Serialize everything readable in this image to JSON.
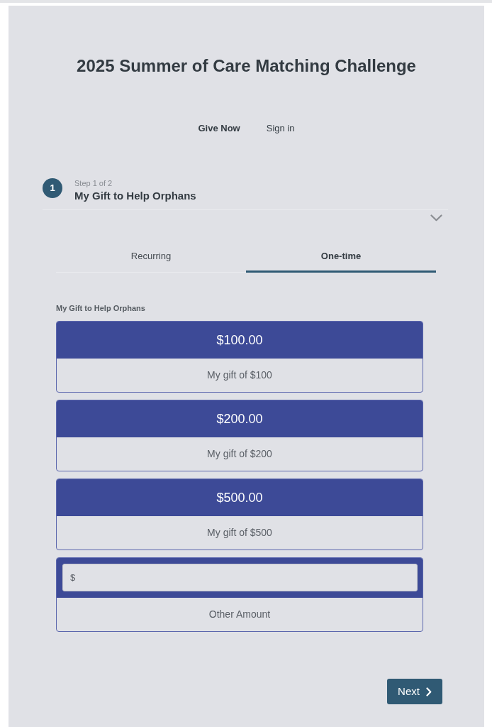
{
  "header": {
    "title": "2025 Summer of Care Matching Challenge"
  },
  "nav": [
    {
      "label": "Give Now",
      "selected": true
    },
    {
      "label": "Sign in",
      "selected": false
    }
  ],
  "step": {
    "number": "1",
    "counter": "Step 1 of 2",
    "title": "My Gift to Help Orphans"
  },
  "frequency_tabs": [
    {
      "label": "Recurring",
      "selected": false
    },
    {
      "label": "One-time",
      "selected": true
    }
  ],
  "gift_field": {
    "label": "My Gift to Help Orphans",
    "options": [
      {
        "kind": "preset",
        "amount": "$100.00",
        "description": "My gift of $100"
      },
      {
        "kind": "preset",
        "amount": "$200.00",
        "description": "My gift of $200"
      },
      {
        "kind": "preset",
        "amount": "$500.00",
        "description": "My gift of $500"
      },
      {
        "kind": "custom",
        "placeholder": "$",
        "description": "Other Amount"
      }
    ]
  },
  "next_button": {
    "label": "Next"
  }
}
